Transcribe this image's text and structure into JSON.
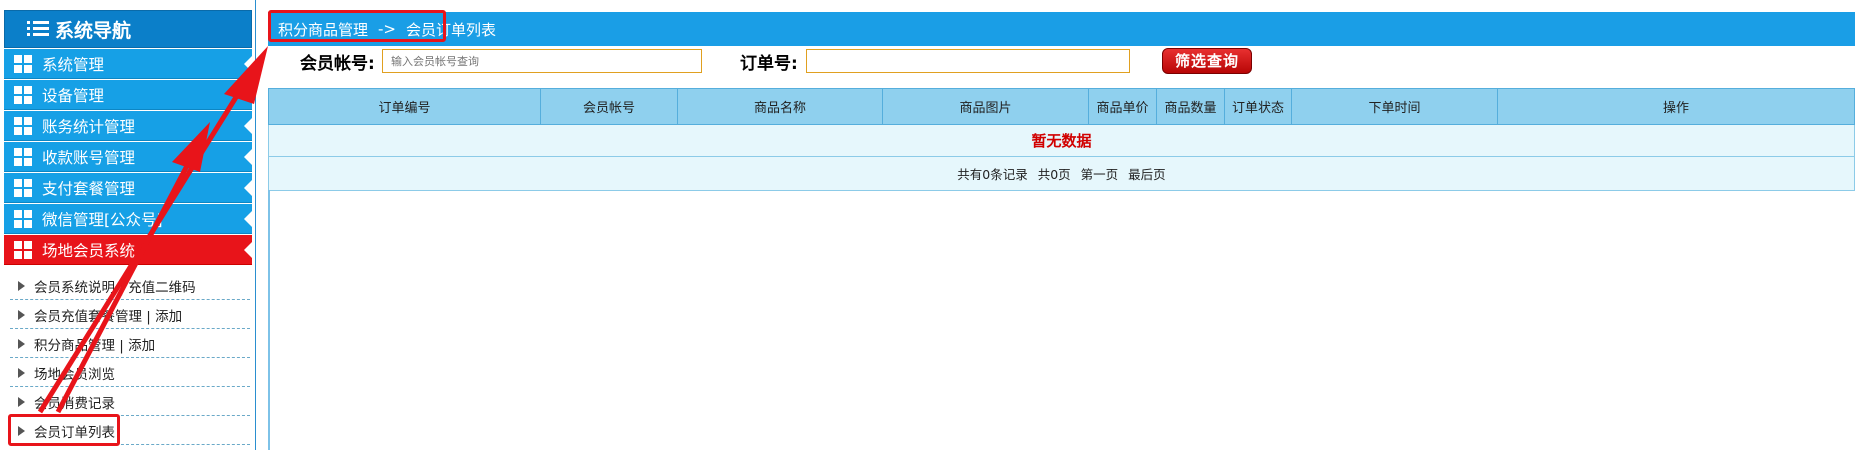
{
  "sidebar": {
    "title": "系统导航",
    "items": [
      {
        "label": "系统管理"
      },
      {
        "label": "设备管理"
      },
      {
        "label": "账务统计管理"
      },
      {
        "label": "收款账号管理"
      },
      {
        "label": "支付套餐管理"
      },
      {
        "label": "微信管理[公众号]"
      },
      {
        "label": "场地会员系统"
      }
    ],
    "subitems": [
      {
        "label": "会员系统说明 | 充值二维码"
      },
      {
        "label": "会员充值套餐管理 | 添加"
      },
      {
        "label": "积分商品管理 | 添加"
      },
      {
        "label": "场地会员浏览"
      },
      {
        "label": "会员消费记录"
      },
      {
        "label": "会员订单列表"
      }
    ]
  },
  "breadcrumb": {
    "parent": "积分商品管理",
    "separator": "->",
    "current": "会员订单列表"
  },
  "filter": {
    "member_label": "会员帐号:",
    "member_placeholder": "输入会员帐号查询",
    "order_label": "订单号:",
    "order_value": "",
    "button_label": "筛选查询"
  },
  "table": {
    "columns": [
      "订单编号",
      "会员帐号",
      "商品名称",
      "商品图片",
      "商品单价",
      "商品数量",
      "订单状态",
      "下单时间",
      "操作"
    ],
    "empty_text": "暂无数据",
    "pager": {
      "records": "共有0条记录",
      "pages": "共0页",
      "first": "第一页",
      "last": "最后页"
    }
  },
  "colors": {
    "accent_blue": "#1a9ee6",
    "active_red": "#e8141a",
    "header_blue": "#8fd0ee"
  }
}
